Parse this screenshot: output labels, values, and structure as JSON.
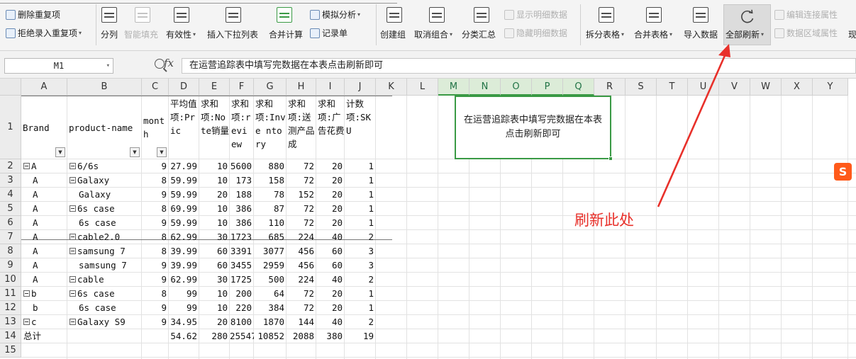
{
  "ribbon": {
    "group1": {
      "remove_dup": "删除重复项",
      "reject_dup": "拒绝录入重复项"
    },
    "group2": {
      "split": "分列",
      "smart_fill": "智能填充",
      "validity": "有效性",
      "dropdown": "插入下拉列表",
      "consolidate": "合并计算",
      "record": "记录单",
      "simulate": "模拟分析"
    },
    "group3": {
      "create_group": "创建组",
      "ungroup": "取消组合",
      "subtotal": "分类汇总",
      "show_detail": "显示明细数据",
      "hide_detail": "隐藏明细数据"
    },
    "group4": {
      "split_table": "拆分表格",
      "merge_table": "合并表格",
      "import": "导入数据",
      "refresh_all": "全部刷新",
      "edit_conn": "编辑连接属性",
      "data_region": "数据区域属性",
      "extra": "现"
    }
  },
  "formula_bar": {
    "name_box": "M1",
    "fx_label": "fx",
    "content": "在运营追踪表中填写完数据在本表点击刷新即可"
  },
  "columns": [
    "A",
    "B",
    "C",
    "D",
    "E",
    "F",
    "G",
    "H",
    "I",
    "J",
    "K",
    "L",
    "M",
    "N",
    "O",
    "P",
    "Q",
    "R",
    "S",
    "T",
    "U",
    "V",
    "W",
    "X",
    "Y"
  ],
  "row_numbers": [
    "1",
    "2",
    "3",
    "4",
    "5",
    "6",
    "7",
    "8",
    "9",
    "10",
    "11",
    "12",
    "13",
    "14",
    "15"
  ],
  "pivot": {
    "headers": [
      "Brand",
      "product-name",
      "month",
      "平均值项:Price",
      "求和项:Note销量",
      "求和项:review",
      "求和项:Inventory",
      "求和项:送测产品成本",
      "求和项:广告花费",
      "计数项:SKU"
    ],
    "header_display": [
      "Brand",
      "product-name",
      "month",
      "平均值项:Pric",
      "求和项:Note销量",
      "求和项:revi ew",
      "求和项:Inve ntory",
      "求和项:送测产品成",
      "求和项:广告花费",
      "计数项:SKU"
    ],
    "rows": [
      [
        "A",
        "6/6s",
        "9",
        "27.99",
        "10",
        "5600",
        "880",
        "72",
        "20",
        "1"
      ],
      [
        "A",
        "Galaxy",
        "8",
        "59.99",
        "10",
        "173",
        "158",
        "72",
        "20",
        "1"
      ],
      [
        "A",
        "Galaxy",
        "9",
        "59.99",
        "20",
        "188",
        "78",
        "152",
        "20",
        "1"
      ],
      [
        "A",
        "6s case",
        "8",
        "69.99",
        "10",
        "386",
        "87",
        "72",
        "20",
        "1"
      ],
      [
        "A",
        "6s case",
        "9",
        "59.99",
        "10",
        "386",
        "110",
        "72",
        "20",
        "1"
      ],
      [
        "A",
        "cable2.0",
        "8",
        "62.99",
        "30",
        "1723",
        "685",
        "224",
        "40",
        "2"
      ],
      [
        "A",
        "samsung 7",
        "8",
        "39.99",
        "60",
        "3391",
        "3077",
        "456",
        "60",
        "3"
      ],
      [
        "A",
        "samsung 7",
        "9",
        "39.99",
        "60",
        "3455",
        "2959",
        "456",
        "60",
        "3"
      ],
      [
        "A",
        "cable",
        "9",
        "62.99",
        "30",
        "1725",
        "500",
        "224",
        "40",
        "2"
      ],
      [
        "b",
        "6s case",
        "8",
        "99",
        "10",
        "200",
        "64",
        "72",
        "20",
        "1"
      ],
      [
        "b",
        "6s case",
        "9",
        "99",
        "10",
        "220",
        "384",
        "72",
        "20",
        "1"
      ],
      [
        "c",
        "Galaxy S9",
        "9",
        "34.95",
        "20",
        "8100",
        "1870",
        "144",
        "40",
        "2"
      ]
    ],
    "total": [
      "总计",
      "",
      "",
      "54.62",
      "280",
      "25547",
      "10852",
      "2088",
      "380",
      "19"
    ]
  },
  "note": "在运营追踪表中填写完数据在本表点击刷新即可",
  "annotation": "刷新此处",
  "ime_icon": "S",
  "colors": {
    "accent_green": "#3a9a45",
    "annotation_red": "#e8302a"
  }
}
